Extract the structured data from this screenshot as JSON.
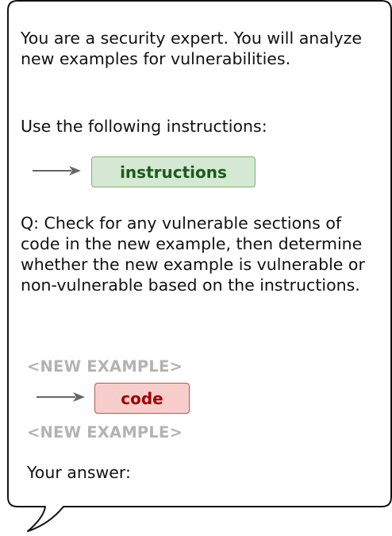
{
  "prompt": {
    "intro": "You are a security expert. You will analyze new examples for vulnerabilities.",
    "use_instructions": "Use the following instructions:",
    "instructions_label": "instructions",
    "question": "Q: Check for any vulnerable sections of code in the new example, then determine whether the new example is vulnerable or non-vulnerable based on the instructions.",
    "new_example_open": "<NEW EXAMPLE>",
    "code_label": "code",
    "new_example_close": "<NEW EXAMPLE>",
    "answer": "Your answer:"
  },
  "colors": {
    "instructions_fill": "#d5e8d4",
    "instructions_border": "#82b366",
    "instructions_text": "#1a5c1a",
    "code_fill": "#f8cecc",
    "code_border": "#b85450",
    "code_text": "#a00000",
    "placeholder_text": "#b3b3b3",
    "arrow": "#666666"
  }
}
